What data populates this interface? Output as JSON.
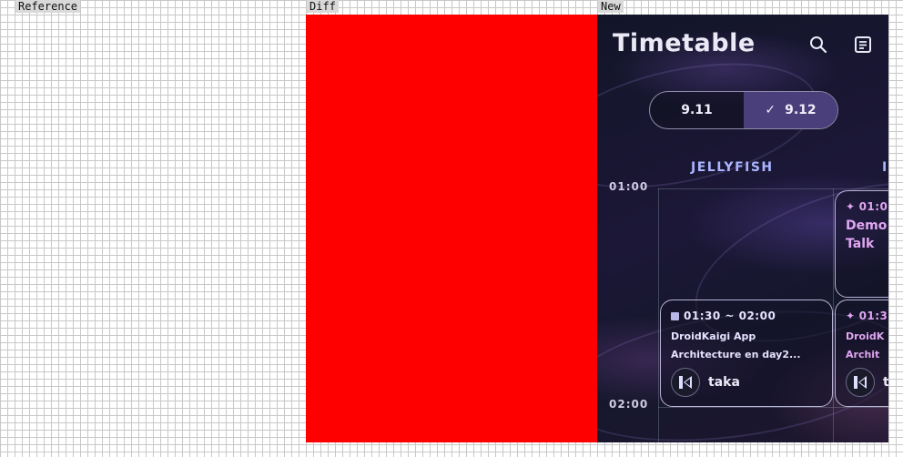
{
  "panels": {
    "reference": "Reference",
    "diff": "Diff",
    "new": "New"
  },
  "app": {
    "title": "Timetable",
    "days": [
      {
        "label": "9.11",
        "selected": false
      },
      {
        "label": "9.12",
        "selected": true
      }
    ],
    "rooms": [
      "JELLYFISH",
      "I"
    ],
    "times": [
      "01:00",
      "02:00"
    ],
    "sessions": {
      "card1": {
        "time": "01:30 ~ 02:00",
        "title_line1": "DroidKaigi App",
        "title_line2": "Architecture en day2...",
        "speaker": "taka"
      },
      "card2": {
        "time": "01:0",
        "title_line1": "Demo",
        "title_line2": "Talk"
      },
      "card3": {
        "time": "01:3",
        "title_line1": "DroidK",
        "title_line2": "Archit",
        "speaker": "t"
      }
    }
  }
}
